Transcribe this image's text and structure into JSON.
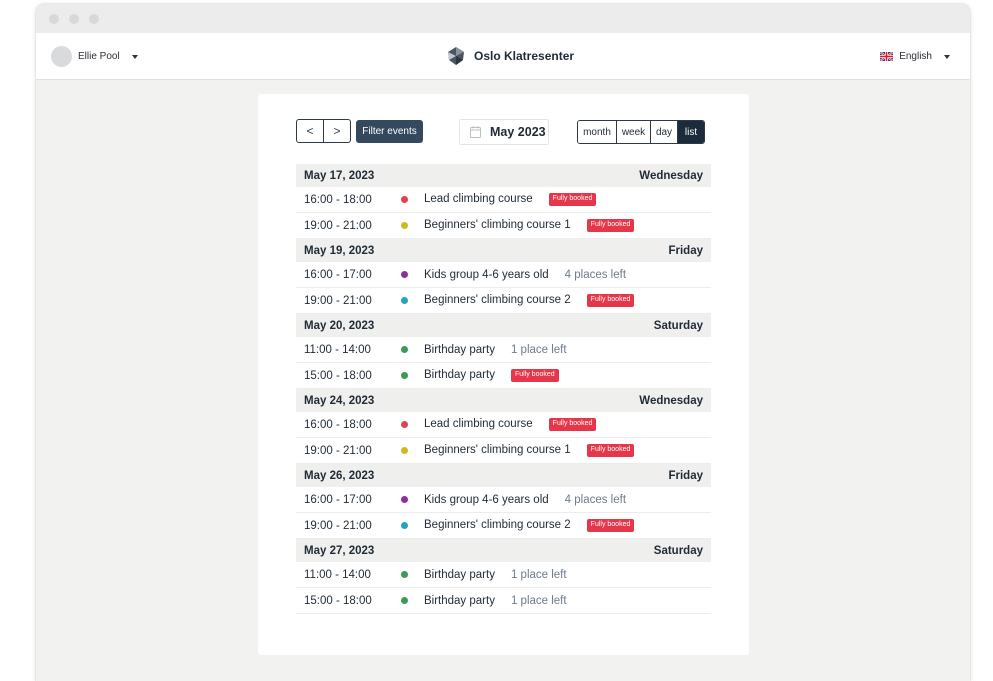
{
  "header": {
    "user_name": "Ellie Pool",
    "brand": "Oslo Klatresenter",
    "language": "English"
  },
  "toolbar": {
    "prev": "<",
    "next": ">",
    "filter": "Filter events",
    "month": "May 2023",
    "views": [
      "month",
      "week",
      "day",
      "list"
    ],
    "active_view": "list"
  },
  "colors": {
    "red": "#e0434f",
    "yellow": "#cdbb1d",
    "purple": "#8e2f9a",
    "teal": "#23a3c2",
    "green": "#3a9a57",
    "badge": "#e5364a",
    "button": "#34495e"
  },
  "days": [
    {
      "date": "May 17, 2023",
      "weekday": "Wednesday",
      "events": [
        {
          "time": "16:00 - 18:00",
          "title": "Lead climbing course",
          "color": "red",
          "status": "Fully booked",
          "booked": true
        },
        {
          "time": "19:00 - 21:00",
          "title": "Beginners' climbing course 1",
          "color": "yellow",
          "status": "Fully booked",
          "booked": true
        }
      ]
    },
    {
      "date": "May 19, 2023",
      "weekday": "Friday",
      "events": [
        {
          "time": "16:00 - 17:00",
          "title": "Kids group 4-6 years old",
          "color": "purple",
          "status": "4 places left",
          "booked": false
        },
        {
          "time": "19:00 - 21:00",
          "title": "Beginners' climbing course 2",
          "color": "teal",
          "status": "Fully booked",
          "booked": true
        }
      ]
    },
    {
      "date": "May 20, 2023",
      "weekday": "Saturday",
      "events": [
        {
          "time": "11:00 - 14:00",
          "title": "Birthday party",
          "color": "green",
          "status": "1 place left",
          "booked": false
        },
        {
          "time": "15:00 - 18:00",
          "title": "Birthday party",
          "color": "green",
          "status": "Fully booked",
          "booked": true
        }
      ]
    },
    {
      "date": "May 24, 2023",
      "weekday": "Wednesday",
      "events": [
        {
          "time": "16:00 - 18:00",
          "title": "Lead climbing course",
          "color": "red",
          "status": "Fully booked",
          "booked": true
        },
        {
          "time": "19:00 - 21:00",
          "title": "Beginners' climbing course 1",
          "color": "yellow",
          "status": "Fully booked",
          "booked": true
        }
      ]
    },
    {
      "date": "May 26, 2023",
      "weekday": "Friday",
      "events": [
        {
          "time": "16:00 - 17:00",
          "title": "Kids group 4-6 years old",
          "color": "purple",
          "status": "4 places left",
          "booked": false
        },
        {
          "time": "19:00 - 21:00",
          "title": "Beginners' climbing course 2",
          "color": "teal",
          "status": "Fully booked",
          "booked": true
        }
      ]
    },
    {
      "date": "May 27, 2023",
      "weekday": "Saturday",
      "events": [
        {
          "time": "11:00 - 14:00",
          "title": "Birthday party",
          "color": "green",
          "status": "1 place left",
          "booked": false
        },
        {
          "time": "15:00 - 18:00",
          "title": "Birthday party",
          "color": "green",
          "status": "1 place left",
          "booked": false
        }
      ]
    }
  ]
}
